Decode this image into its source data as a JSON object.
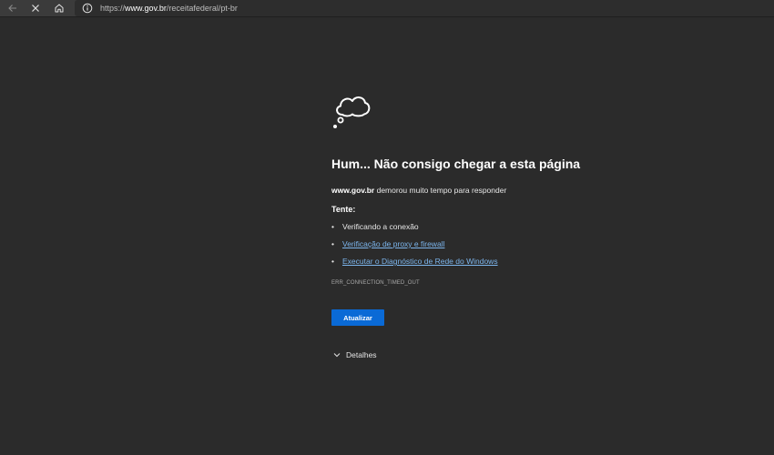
{
  "toolbar": {
    "back_icon": "arrow-left-icon",
    "stop_icon": "close-icon",
    "home_icon": "home-icon"
  },
  "address_bar": {
    "info_icon": "info-icon",
    "url_prefix": "https://",
    "url_host": "www.gov.br",
    "url_path": "/receitafederal/pt-br"
  },
  "error": {
    "icon": "cloud-thought-icon",
    "title": "Hum... Não consigo chegar a esta página",
    "host": "www.gov.br",
    "description": " demorou muito tempo para responder",
    "try_label": "Tente:",
    "suggestions": [
      {
        "text": "Verificando a conexão",
        "link": false
      },
      {
        "text": "Verificação de proxy e firewall",
        "link": true
      },
      {
        "text": "Executar o Diagnóstico de Rede do Windows",
        "link": true
      }
    ],
    "code": "ERR_CONNECTION_TIMED_OUT",
    "refresh_label": "Atualizar",
    "details_label": "Detalhes",
    "details_icon": "chevron-down-icon"
  },
  "colors": {
    "background": "#2b2b2b",
    "toolbar": "#3b3b3b",
    "address": "#2d2d2d",
    "accent": "#0a6ad6",
    "link": "#7cb5ec"
  }
}
